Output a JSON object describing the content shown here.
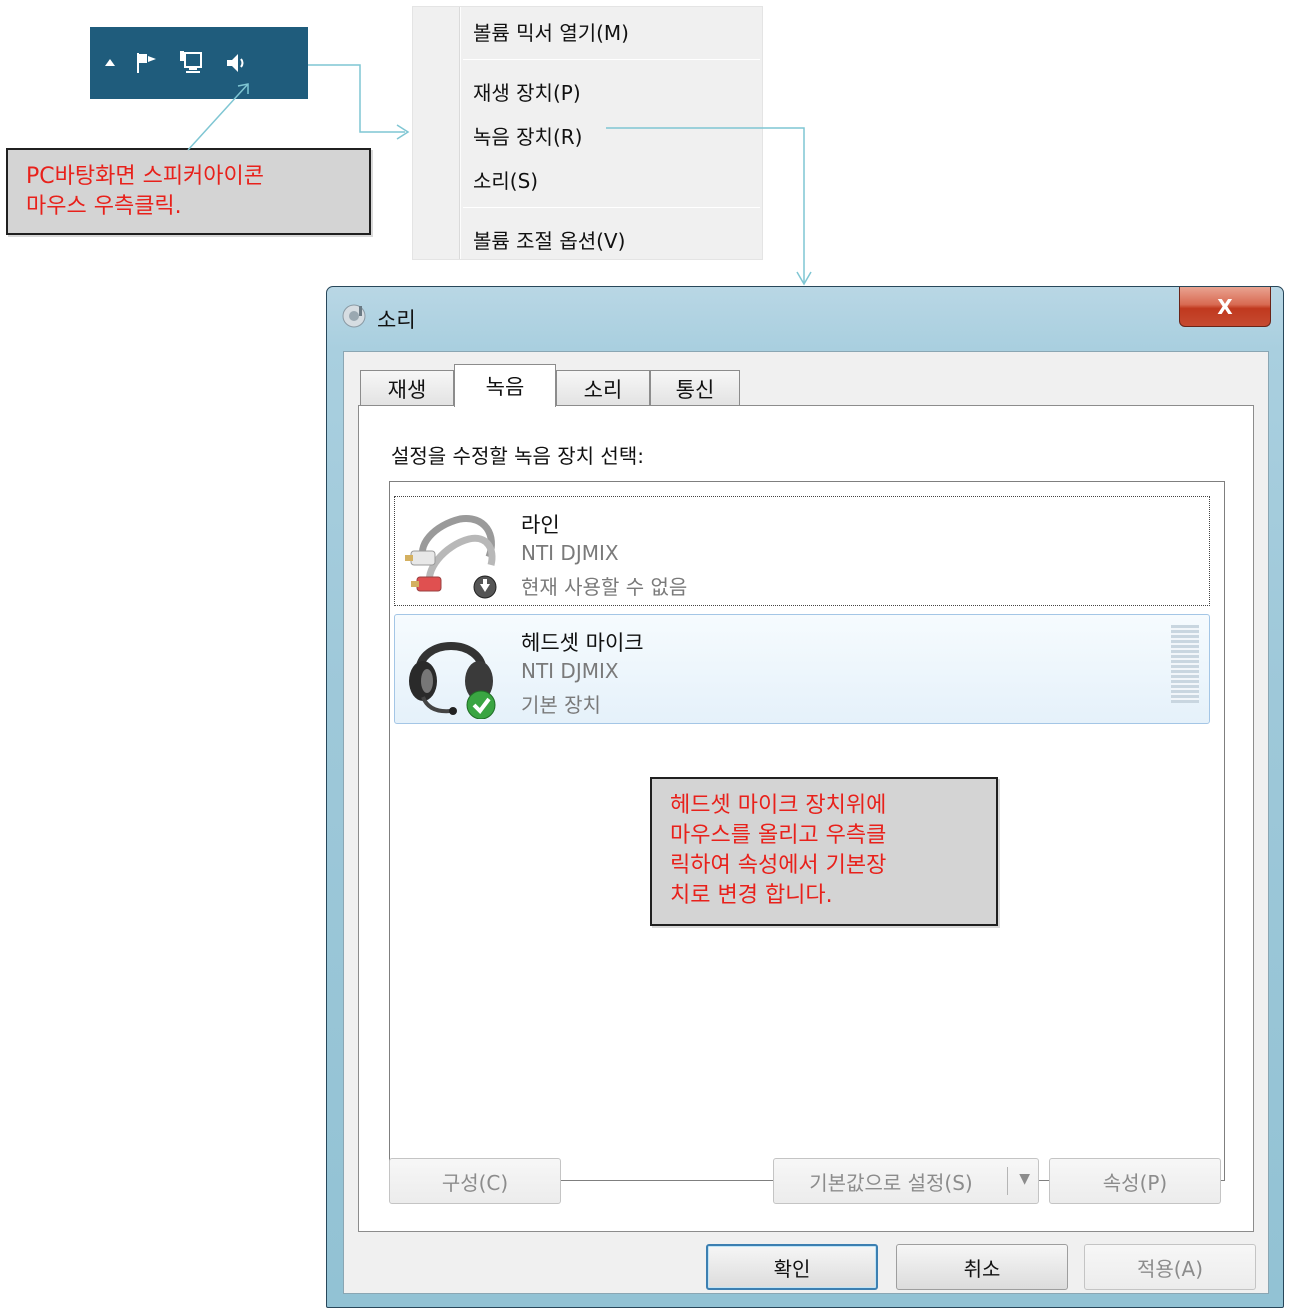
{
  "tray": {
    "icons": [
      "up-arrow-icon",
      "action-center-flag-icon",
      "network-icon",
      "speaker-icon"
    ]
  },
  "notes": {
    "tray_note": [
      "PC바탕화면 스피커아이콘",
      "마우스 우측클릭."
    ],
    "headset_note": [
      "헤드셋 마이크 장치위에",
      "마우스를 올리고 우측클",
      "릭하여 속성에서 기본장",
      "치로 변경 합니다."
    ]
  },
  "context_menu": {
    "items": [
      "볼륨 믹서 열기(M)",
      "재생 장치(P)",
      "녹음 장치(R)",
      "소리(S)",
      "볼륨 조절 옵션(V)"
    ]
  },
  "dialog": {
    "title": "소리",
    "close_label": "X",
    "tabs": [
      "재생",
      "녹음",
      "소리",
      "통신"
    ],
    "active_tab": "녹음",
    "hint": "설정을 수정할 녹음 장치 선택:",
    "devices": [
      {
        "name": "라인",
        "driver": "NTI DJMIX",
        "status": "현재 사용할 수 없음"
      },
      {
        "name": "헤드셋 마이크",
        "driver": "NTI DJMIX",
        "status": "기본 장치"
      }
    ],
    "buttons": {
      "configure": "구성(C)",
      "set_default": "기본값으로 설정(S)",
      "properties": "속성(P)",
      "ok": "확인",
      "cancel": "취소",
      "apply": "적용(A)"
    }
  },
  "colors": {
    "taskbar": "#1f5c7c",
    "note_text": "#e8211b",
    "connector": "#7fc6d3"
  }
}
